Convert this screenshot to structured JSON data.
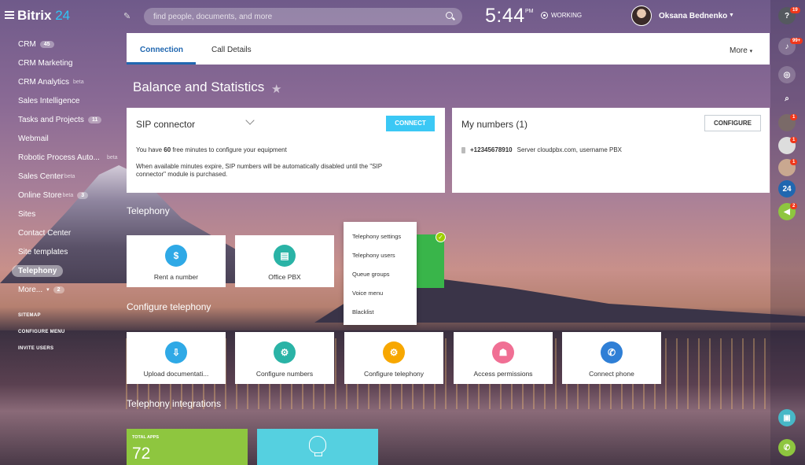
{
  "header": {
    "app_name": "Bitrix",
    "app_version": "24",
    "search_placeholder": "find people, documents, and more",
    "time": "5:44",
    "ampm": "PM",
    "status": "WORKING",
    "user_name": "Oksana Bednenko"
  },
  "sidebar": {
    "items": [
      {
        "label": "CRM",
        "badge": "45"
      },
      {
        "label": "CRM Marketing"
      },
      {
        "label": "CRM Analytics",
        "sup": "beta"
      },
      {
        "label": "Sales Intelligence"
      },
      {
        "label": "Tasks and Projects",
        "badge": "11"
      },
      {
        "label": "Webmail"
      },
      {
        "label": "Robotic Process Auto...",
        "sup": "beta"
      },
      {
        "label": "Sales Center",
        "sup": "beta"
      },
      {
        "label": "Online Store",
        "sup": "beta",
        "badge": "3"
      },
      {
        "label": "Sites"
      },
      {
        "label": "Contact Center"
      },
      {
        "label": "Site templates"
      },
      {
        "label": "Telephony"
      },
      {
        "label": "More...",
        "badge": "2"
      }
    ],
    "footer": [
      "SITEMAP",
      "CONFIGURE MENU",
      "INVITE USERS"
    ]
  },
  "rail": {
    "help_badge": "19",
    "notifications_badge": "99+",
    "avatar_badges": [
      "1",
      "1",
      "1"
    ],
    "b24_label": "24",
    "announce_badge": "2"
  },
  "tabs": {
    "connection": "Connection",
    "call_details": "Call Details",
    "more": "More"
  },
  "page_title": "Balance and Statistics",
  "sip_card": {
    "title": "SIP connector",
    "button": "CONNECT",
    "line1_pre": "You have ",
    "line1_num": "60",
    "line1_post": " free minutes to configure your equipment",
    "line2": "When available minutes expire, SIP numbers will be automatically disabled until the \"SIP",
    "line3": "connector\" module is purchased."
  },
  "numbers_card": {
    "title": "My numbers (1)",
    "button": "CONFIGURE",
    "phone": "+12345678910",
    "server": "Server cloudpbx.com, username PBX"
  },
  "telephony": {
    "title": "Telephony",
    "tiles": [
      "Rent a number",
      "Office PBX"
    ],
    "menu": [
      "Telephony settings",
      "Telephony users",
      "Queue groups",
      "Voice menu",
      "Blacklist"
    ]
  },
  "configure": {
    "title": "Configure telephony",
    "tiles": [
      "Upload documentati...",
      "Configure numbers",
      "Configure telephony",
      "Access permissions",
      "Connect phone"
    ]
  },
  "integrations": {
    "title": "Telephony integrations",
    "total_apps_label": "TOTAL APPS",
    "total_apps_count": "72"
  },
  "colors": {
    "accent": "#2067b0",
    "connect_button": "#3bc8f5",
    "apps_tile": "#8ec63f",
    "idea_tile": "#55d0e0"
  }
}
